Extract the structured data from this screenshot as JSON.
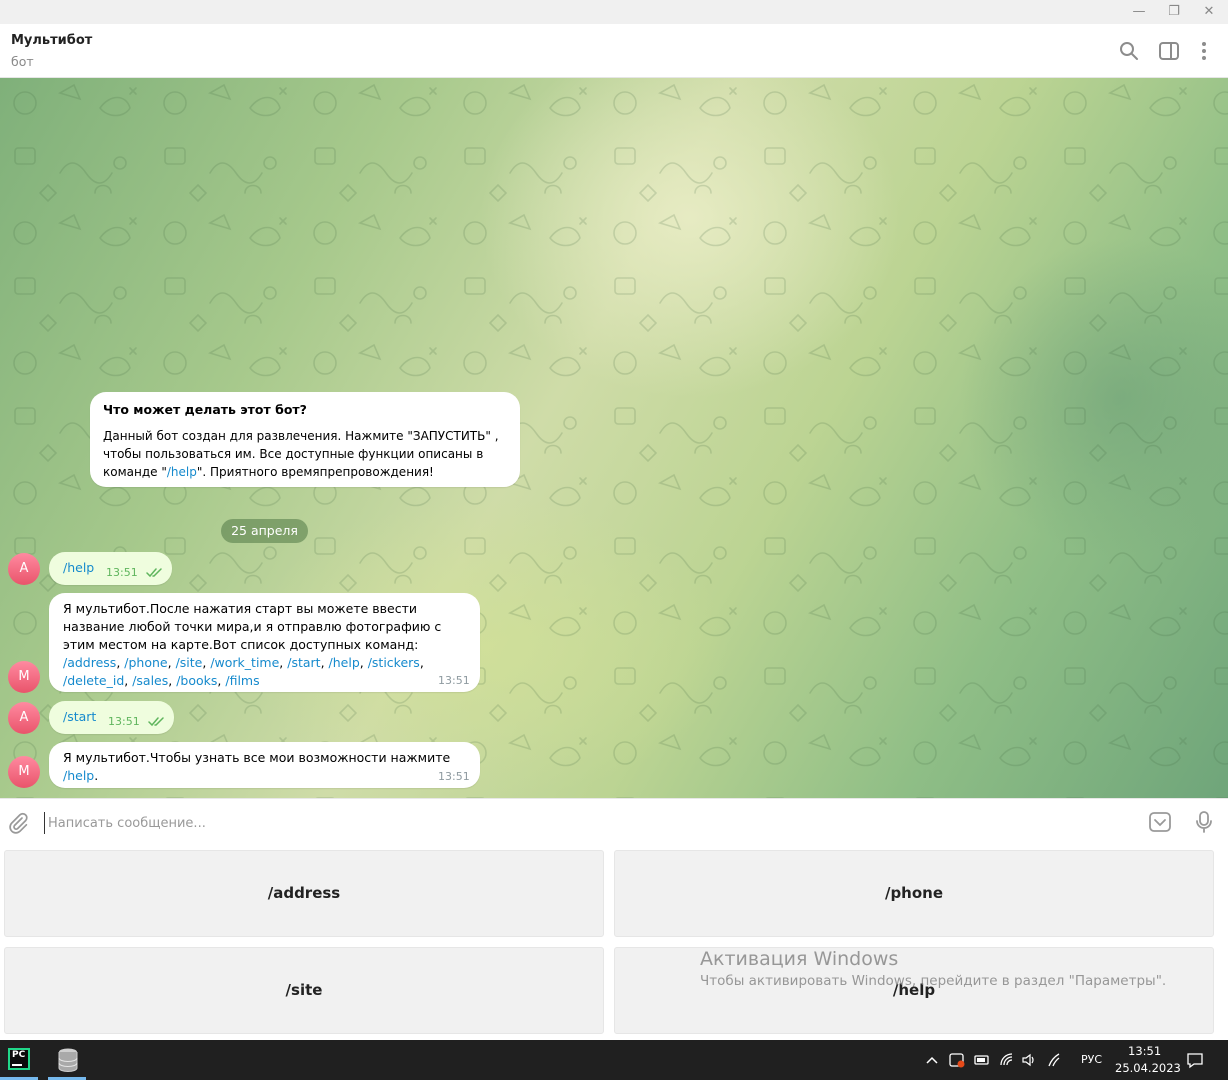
{
  "window": {
    "minimize_glyph": "—",
    "restore_glyph": "❐",
    "close_glyph": "✕"
  },
  "header": {
    "title": "Мультибот",
    "subtitle": "бот",
    "icons": [
      "search-icon",
      "sidebar-toggle-icon",
      "more-vertical-icon"
    ]
  },
  "intro_card": {
    "title": "Что может делать этот бот?",
    "body_before": "Данный бот создан для развлечения. Нажмите \"ЗАПУСТИТЬ\" , чтобы пользоваться им. Все доступные функции описаны в команде \"",
    "body_link": "/help",
    "body_after": "\". Приятного времяпрепровождения!"
  },
  "date_separator": "25 апреля",
  "messages": [
    {
      "sender": "A",
      "text": "/help",
      "time": "13:51"
    },
    {
      "sender": "M",
      "text": "Я мультибот.После нажатия старт вы можете ввести название любой точки мира,и я отправлю фотографию с этим местом на карте.Вот список доступных команд: ",
      "commands": [
        "/address",
        "/phone",
        "/site",
        "/work_time",
        "/start",
        "/help",
        "/stickers",
        "/delete_id",
        "/sales",
        "/books",
        "/films"
      ],
      "sep": ", ",
      "time": "13:51"
    },
    {
      "sender": "A",
      "text": "/start",
      "time": "13:51"
    },
    {
      "sender": "M",
      "text": "Я мультибот.Чтобы узнать все мои возможности нажмите ",
      "link": "/help",
      "after": ".",
      "time": "13:51"
    }
  ],
  "composer": {
    "placeholder": "Написать сообщение..."
  },
  "keyboard": {
    "buttons": [
      "/address",
      "/phone",
      "/site",
      "/help"
    ]
  },
  "watermark": {
    "title": "Активация Windows",
    "subtitle": "Чтобы активировать Windows, перейдите в раздел \"Параметры\"."
  },
  "taskbar": {
    "pycharm_label": "PC",
    "language": "РУС",
    "time": "13:51",
    "date": "25.04.2023"
  },
  "colors": {
    "link": "#168acd",
    "outgoing_bubble": "#effdde",
    "avatar": "#e9546b",
    "checkmarks": "#5fb55d"
  }
}
